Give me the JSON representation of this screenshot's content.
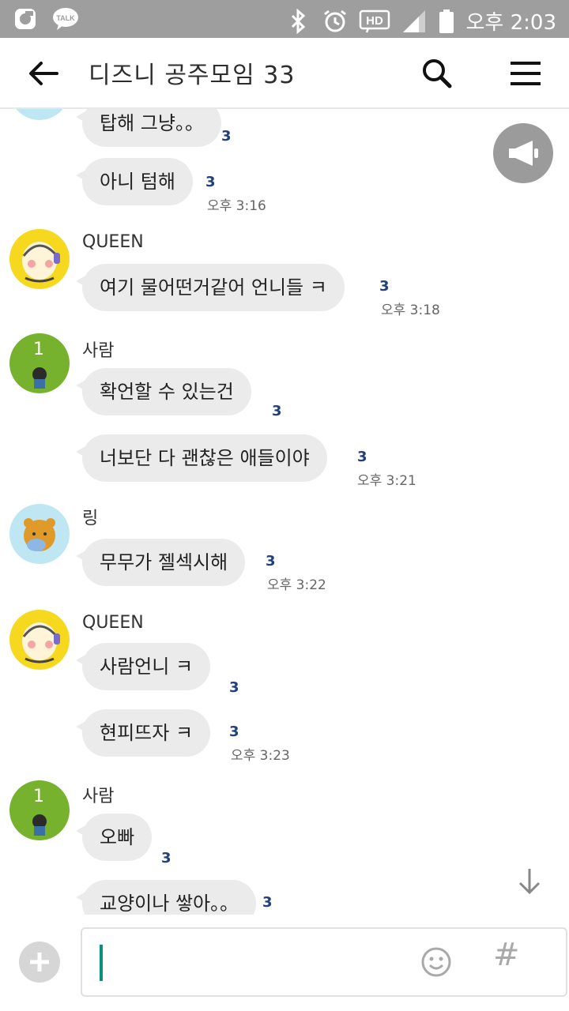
{
  "status_bar": {
    "app_icons": [
      "o-icon",
      "kakaotalk-icon"
    ],
    "talk_badge": "TALK",
    "system_icons": [
      "bluetooth-icon",
      "alarm-icon",
      "hd-icon",
      "signal-icon",
      "battery-icon"
    ],
    "hd_label": "HD",
    "time": "오후 2:03"
  },
  "header": {
    "title": "디즈니 공주모임 33"
  },
  "messages": [
    {
      "text": "탑해 그냥。。",
      "unread": "3"
    },
    {
      "text": "아니 텀해",
      "unread": "3",
      "time": "오후 3:16"
    },
    {
      "sender": "QUEEN",
      "text": "여기 물어떤거같어 언니들 ㅋ",
      "unread": "3",
      "time": "오후 3:18"
    },
    {
      "sender": "사람",
      "text": "확언할 수 있는건",
      "unread": "3"
    },
    {
      "text": "너보단 다 괜찮은 애들이야",
      "unread": "3",
      "time": "오후 3:21"
    },
    {
      "sender": "링",
      "text": "무무가 젤섹시해",
      "unread": "3",
      "time": "오후 3:22"
    },
    {
      "sender": "QUEEN",
      "text": "사람언니 ㅋ",
      "unread": "3"
    },
    {
      "text": "현피뜨자 ㅋ",
      "unread": "3",
      "time": "오후 3:23"
    },
    {
      "sender": "사람",
      "text": "오빠",
      "unread": "3"
    },
    {
      "text": "교양이나 쌓아。。",
      "unread": "3"
    }
  ],
  "avatars": {
    "person_badge": "1"
  },
  "composer": {
    "hash_label": "#"
  },
  "colors": {
    "status_bar": "#9e9e9e",
    "bubble": "#ebebeb",
    "unread": "#1f3f7d",
    "caret": "#0a8f83"
  }
}
